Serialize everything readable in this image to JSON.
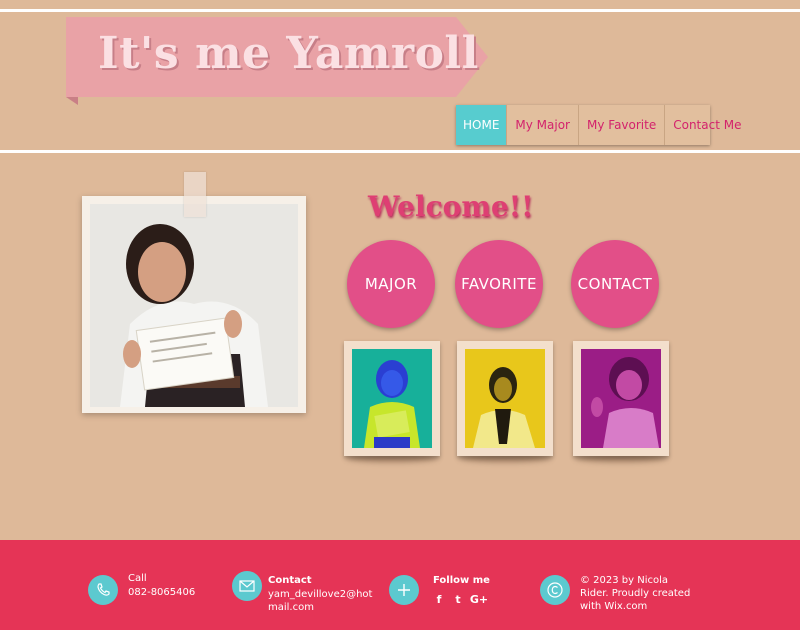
{
  "header": {
    "title": "It's me Yamroll"
  },
  "nav": {
    "items": [
      {
        "label": "HOME",
        "active": true
      },
      {
        "label": "My Major"
      },
      {
        "label": "My Favorite"
      },
      {
        "label": "Contact Me"
      }
    ]
  },
  "main": {
    "welcome": "Welcome!!",
    "circles": [
      {
        "label": "MAJOR"
      },
      {
        "label": "FAVORITE"
      },
      {
        "label": "CONTACT"
      }
    ]
  },
  "footer": {
    "call_label": "Call",
    "call_number": "082-8065406",
    "contact_label": "Contact",
    "contact_email": "yam_devillove2@hotmail.com",
    "follow_label": "Follow me",
    "social": [
      "f",
      "t",
      "G+"
    ],
    "copyright": "© 2023 by Nicola Rider. Proudly created with Wix.com"
  },
  "colors": {
    "background": "#deb999",
    "accent_pink": "#e24f88",
    "accent_teal": "#57cccf",
    "footer_red": "#e53456"
  }
}
